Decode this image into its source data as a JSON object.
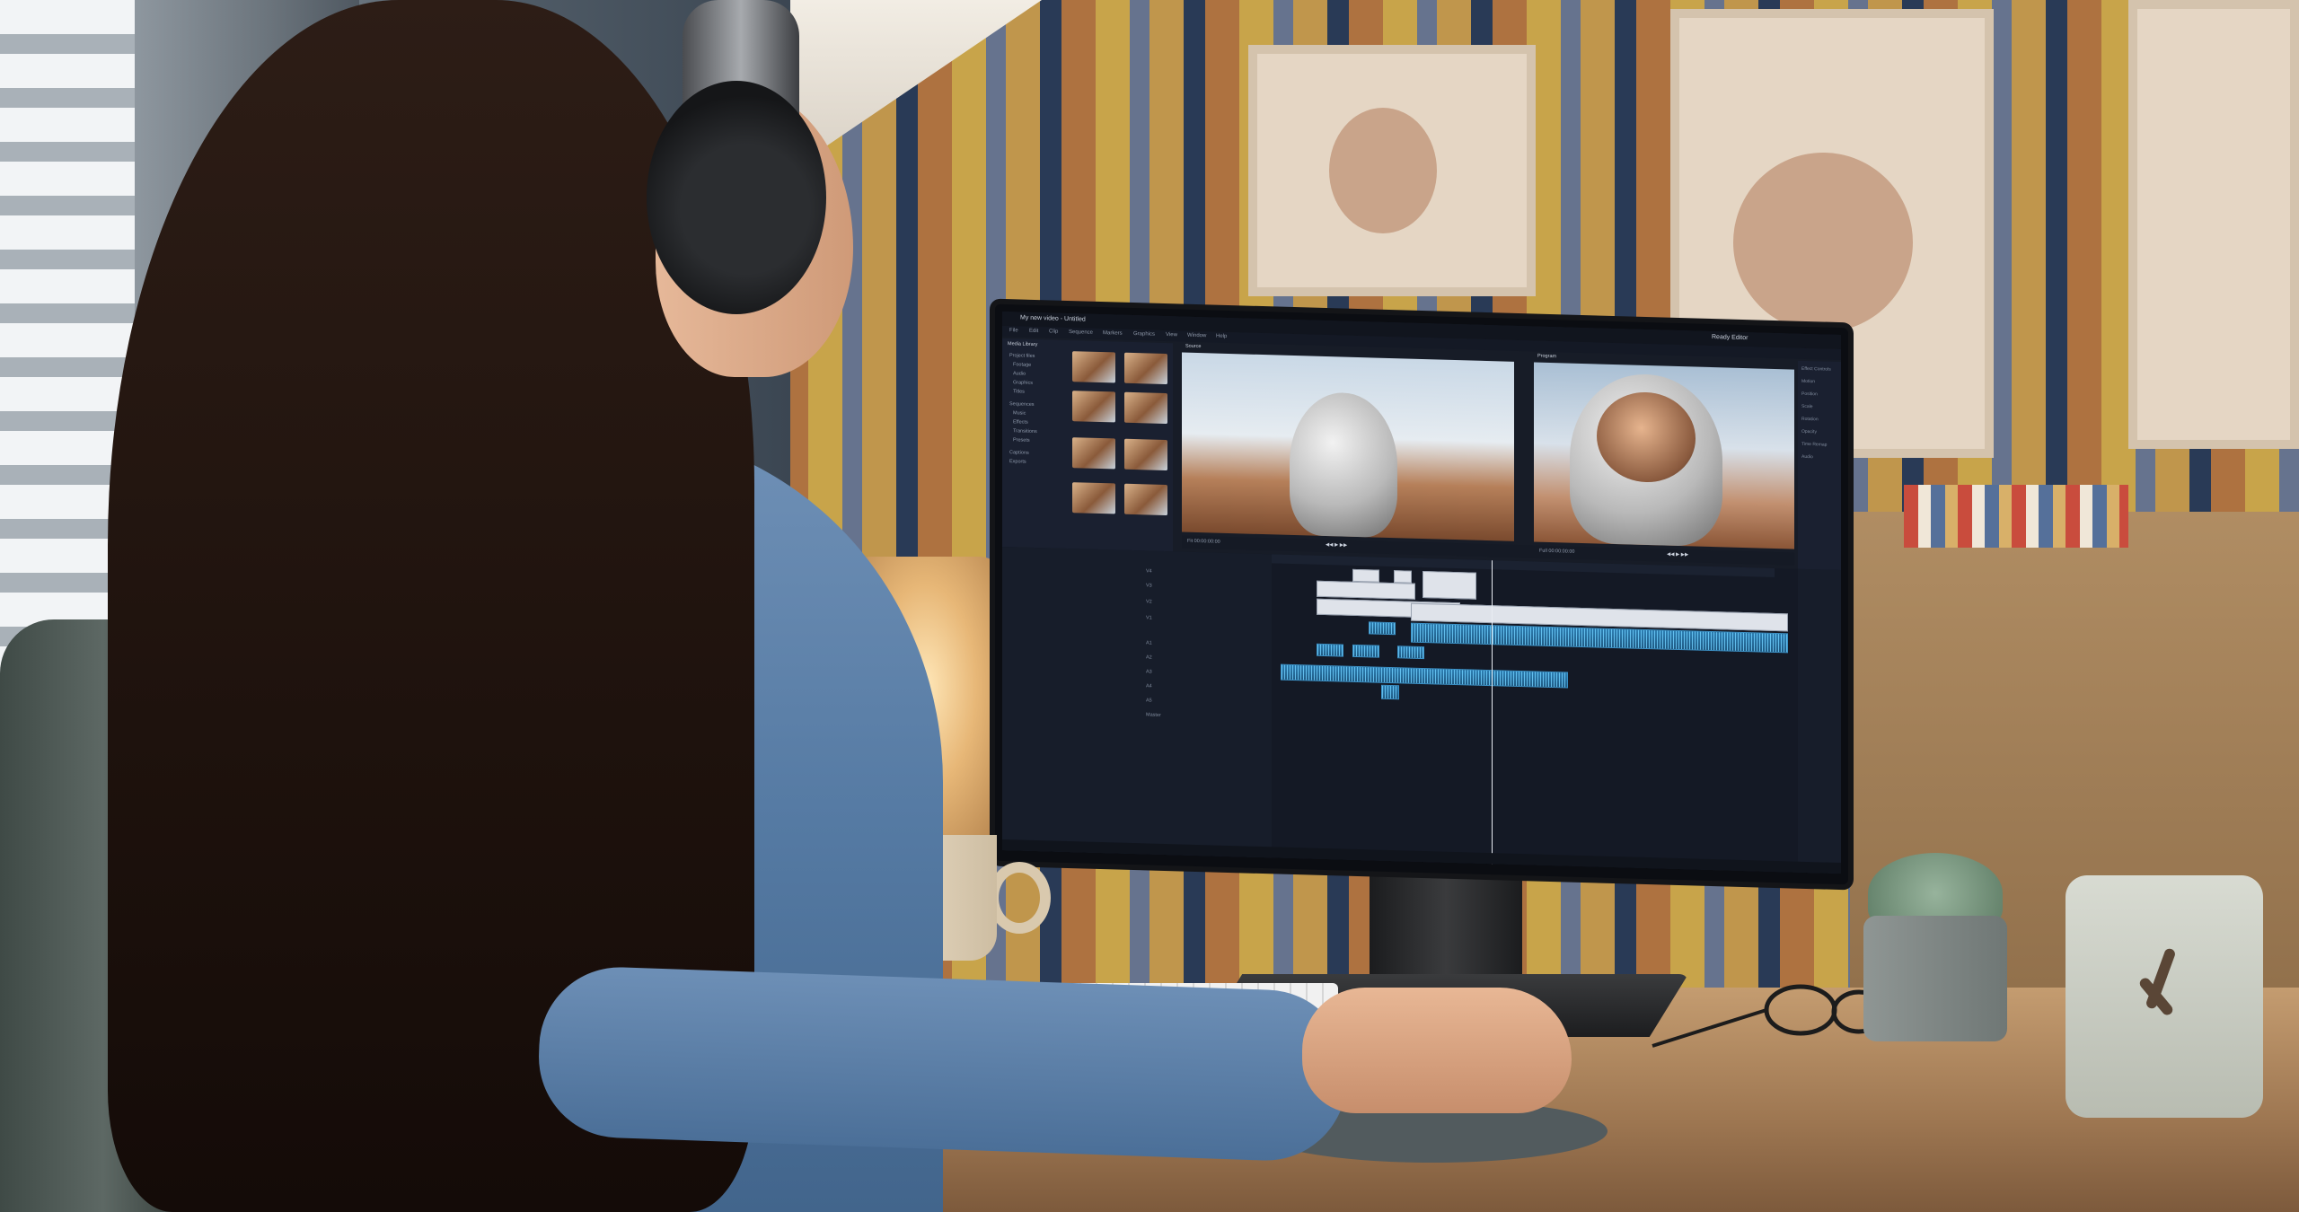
{
  "scene": {
    "description_tag": "photo-of-video-editor-workstation"
  },
  "editor": {
    "title": "My new video - Untitled",
    "window_controls_text": "Ready Editor",
    "menus": [
      "File",
      "Edit",
      "Clip",
      "Sequence",
      "Markers",
      "Graphics",
      "View",
      "Window",
      "Help"
    ],
    "browser_header": "Media Library",
    "browser_items": [
      "Project files",
      "Footage",
      "Audio",
      "Graphics",
      "Titles",
      "Sequences",
      "Music",
      "Effects",
      "Transitions",
      "Presets",
      "Captions",
      "Exports"
    ],
    "viewer_left_label": "Source",
    "viewer_right_label": "Program",
    "transport_left": "Fit  00:00:00:00",
    "transport_right": "Full  00:00:00:00",
    "track_labels": [
      "V4",
      "V3",
      "V2",
      "V1",
      "A1",
      "A2",
      "A3",
      "A4",
      "A5",
      "Master"
    ],
    "inspector_rows": [
      "Effect Controls",
      "Motion",
      "Position",
      "Scale",
      "Rotation",
      "Opacity",
      "Time Remap",
      "Audio"
    ]
  }
}
